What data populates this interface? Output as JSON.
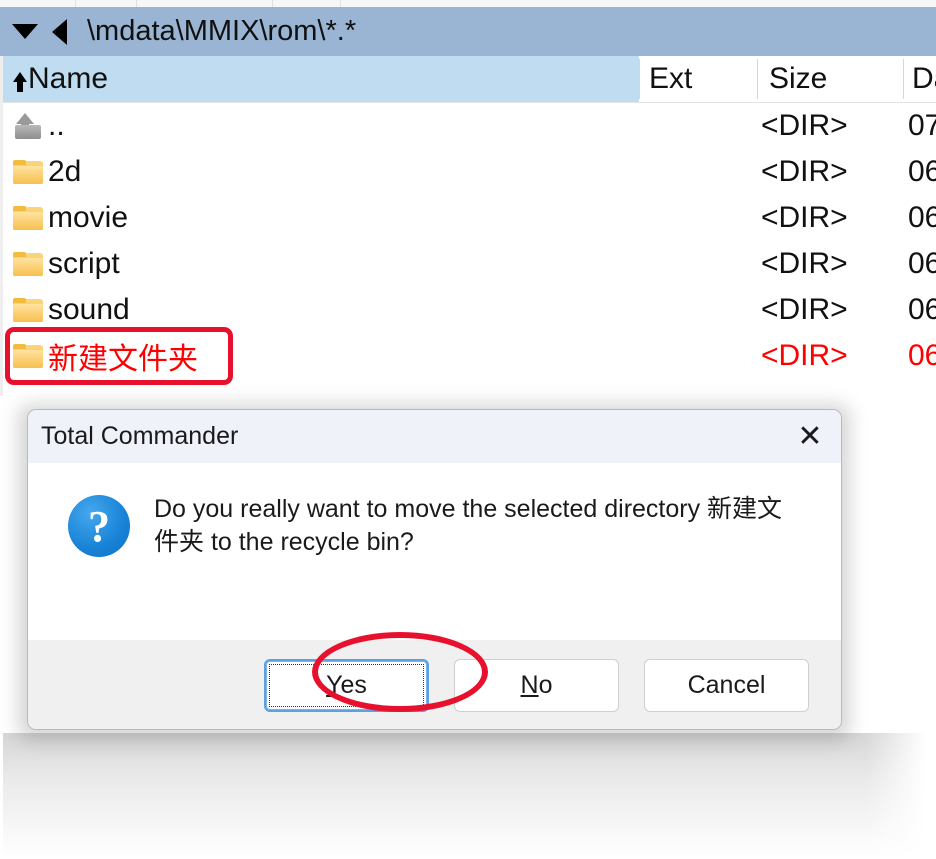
{
  "window": {
    "path_bar": {
      "history_icon": "triangle-down-icon",
      "back_icon": "triangle-left-icon",
      "path": "\\mdata\\MMIX\\rom\\*.*"
    },
    "columns": [
      {
        "key": "name",
        "label": "Name",
        "sorted": true,
        "sort_icon": "sort-ascending-icon"
      },
      {
        "key": "ext",
        "label": "Ext"
      },
      {
        "key": "size",
        "label": "Size"
      },
      {
        "key": "date",
        "label": "Da"
      }
    ],
    "rows": [
      {
        "icon": "up-directory-icon",
        "name": "..",
        "ext": "",
        "size": "<DIR>",
        "date": "07,",
        "marked": false
      },
      {
        "icon": "folder-icon",
        "name": "2d",
        "ext": "",
        "size": "<DIR>",
        "date": "06,",
        "marked": false
      },
      {
        "icon": "folder-icon",
        "name": "movie",
        "ext": "",
        "size": "<DIR>",
        "date": "06,",
        "marked": false
      },
      {
        "icon": "folder-icon",
        "name": "script",
        "ext": "",
        "size": "<DIR>",
        "date": "06,",
        "marked": false
      },
      {
        "icon": "folder-icon",
        "name": "sound",
        "ext": "",
        "size": "<DIR>",
        "date": "06,",
        "marked": false
      },
      {
        "icon": "folder-icon",
        "name": "新建文件夹",
        "ext": "",
        "size": "<DIR>",
        "date": "06,",
        "marked": true
      }
    ]
  },
  "dialog": {
    "title": "Total Commander",
    "close_icon": "close-icon",
    "question_icon": "question-mark-icon",
    "message": "Do you really want to move the selected directory 新建文件夹 to the recycle bin?",
    "buttons": [
      {
        "id": "yes",
        "label": "Yes",
        "accel": "Y",
        "rest": "es",
        "default": true
      },
      {
        "id": "no",
        "label": "No",
        "accel": "N",
        "rest": "o",
        "default": false
      },
      {
        "id": "cancel",
        "label": "Cancel",
        "accel": "",
        "rest": "Cancel",
        "default": false
      }
    ]
  },
  "annotations": {
    "rect_target": "新建文件夹",
    "ellipse_target": "Yes",
    "color": "#e8112d"
  },
  "colors": {
    "path_bar_bg": "#9ab5d4",
    "column_selected_bg": "#bfdcf0",
    "marked_row_text": "#ff0000",
    "dialog_title_bg": "#eff2f9",
    "dialog_footer_bg": "#f0f0f0",
    "default_button_border": "#5ba0e0",
    "question_icon_bg": "#1782d6"
  }
}
